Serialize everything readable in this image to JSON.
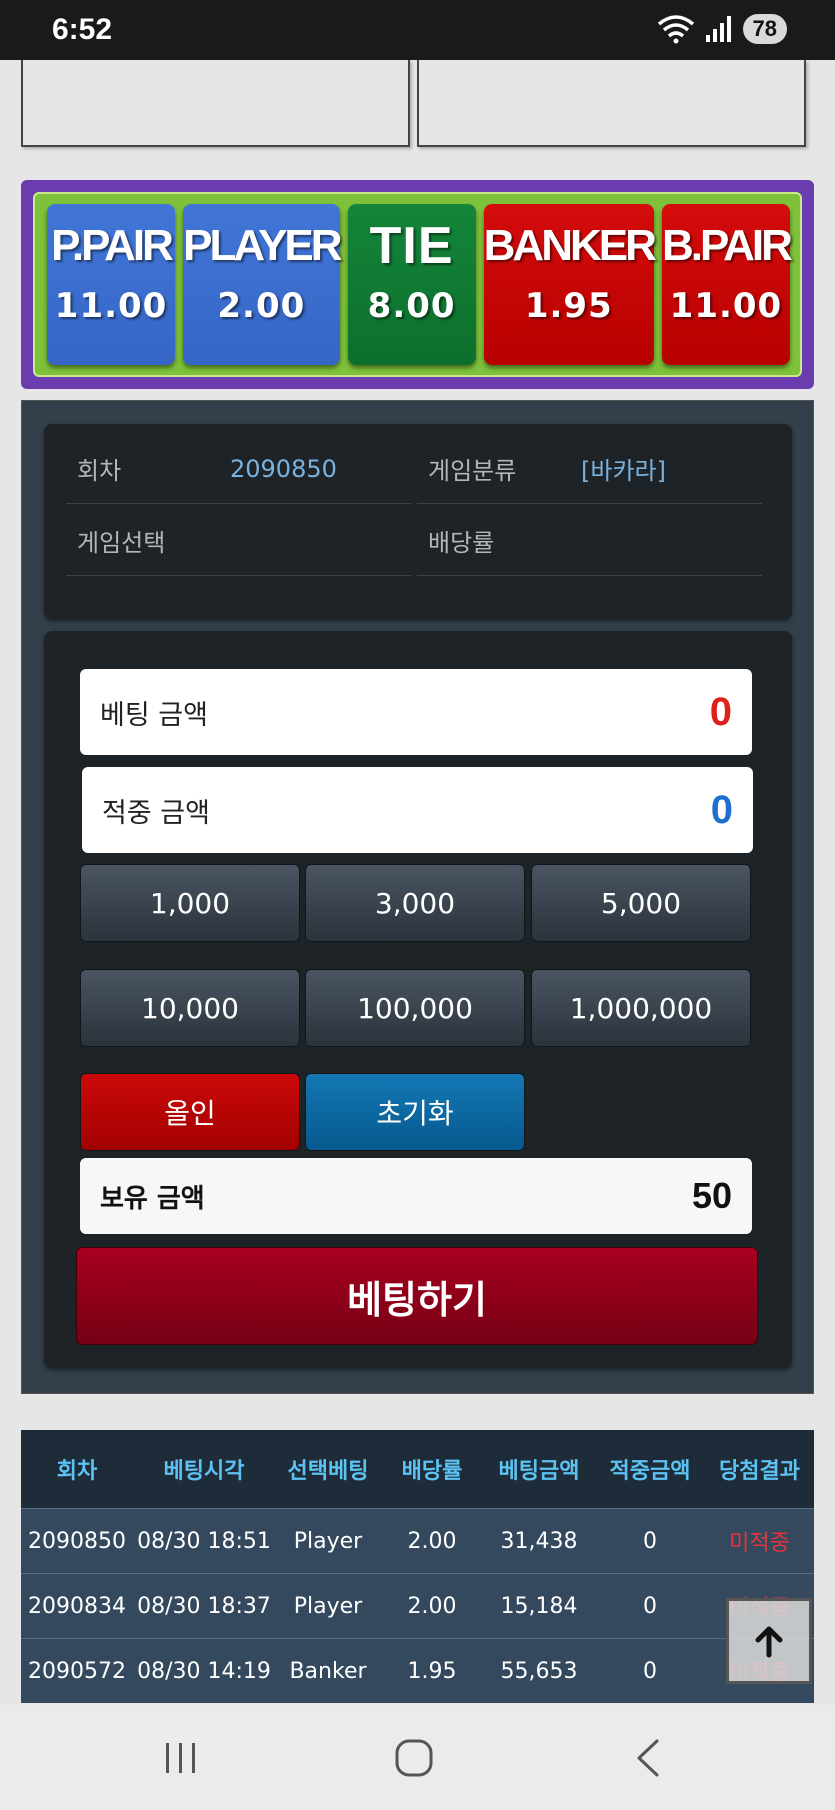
{
  "status_bar": {
    "time": "6:52",
    "battery": "78"
  },
  "odds": [
    {
      "name": "P.PAIR",
      "value": "11.00"
    },
    {
      "name": "PLAYER",
      "value": "2.00"
    },
    {
      "name": "TIE",
      "value": "8.00"
    },
    {
      "name": "BANKER",
      "value": "1.95"
    },
    {
      "name": "B.PAIR",
      "value": "11.00"
    }
  ],
  "info": {
    "round_label": "회차",
    "round_value": "2090850",
    "category_label": "게임분류",
    "category_value": "[바카라]",
    "selection_label": "게임선택",
    "odds_label": "배당률"
  },
  "bet": {
    "amount_label": "베팅 금액",
    "amount_value": "0",
    "win_label": "적중 금액",
    "win_value": "0",
    "chips": [
      "1,000",
      "3,000",
      "5,000",
      "10,000",
      "100,000",
      "1,000,000"
    ],
    "allin_label": "올인",
    "reset_label": "초기화",
    "hold_label": "보유 금액",
    "hold_value": "50",
    "submit_label": "베팅하기"
  },
  "history": {
    "headers": [
      "회차",
      "베팅시각",
      "선택베팅",
      "배당률",
      "베팅금액",
      "적중금액",
      "당첨결과"
    ],
    "rows": [
      [
        "2090850",
        "08/30 18:51",
        "Player",
        "2.00",
        "31,438",
        "0",
        "미적중"
      ],
      [
        "2090834",
        "08/30 18:37",
        "Player",
        "2.00",
        "15,184",
        "0",
        "미적중"
      ],
      [
        "2090572",
        "08/30 14:19",
        "Banker",
        "1.95",
        "55,653",
        "0",
        "미적중"
      ]
    ]
  },
  "colors": {
    "bet_amount": "#e0201c",
    "win_amount": "#1f6fd1",
    "odds_frame": "#6a3cb0",
    "odds_bg": "#7ec13a"
  }
}
